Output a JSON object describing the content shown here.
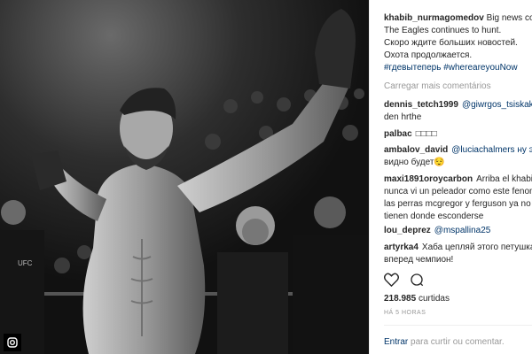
{
  "post": {
    "username": "khabib_nurmagomedov",
    "caption_line1_rest": " Big news com",
    "caption_line2": "The Eagles continues to hunt.",
    "caption_line3": "Скоро ждите больших новостей.",
    "caption_line4": "Охота продолжается.",
    "hashtags": "#гдевытеперь #whereareyouNow",
    "load_more": "Carregar mais comentários"
  },
  "comments": [
    {
      "user": "dennis_tetch1999",
      "text": "@giwrgos_tsiskakis a",
      "mention": true,
      "line2": "den hrthe"
    },
    {
      "user": "palbac",
      "text": "□□□□",
      "mention": false,
      "line2": ""
    },
    {
      "user": "ambalov_david",
      "text": "@luciachalmers ну это",
      "mention": true,
      "line2": "видно будет😌"
    },
    {
      "user": "maxi1891oroycarbon",
      "text": "Arriba el khabib",
      "mention": false,
      "line2": "nunca vi un peleador como este fenom",
      "line3": "las perras mcgregor y ferguson ya no",
      "line4": "tienen donde esconderse"
    },
    {
      "user": "lou_deprez",
      "text": "@mspallina25",
      "mention": true,
      "line2": ""
    },
    {
      "user": "artyrka4",
      "text": "Хаба цепляй этого петушка.",
      "mention": false,
      "line2": "вперед чемпион!"
    }
  ],
  "stats": {
    "likes_number": "218.985",
    "likes_label": "curtidas",
    "time_ago": "HÁ 5 HORAS"
  },
  "login": {
    "link": "Entrar",
    "rest": " para curtir ou comentar."
  },
  "icons": {
    "like": "heart-icon",
    "comment": "comment-bubble-icon",
    "corner": "instagram-icon"
  }
}
